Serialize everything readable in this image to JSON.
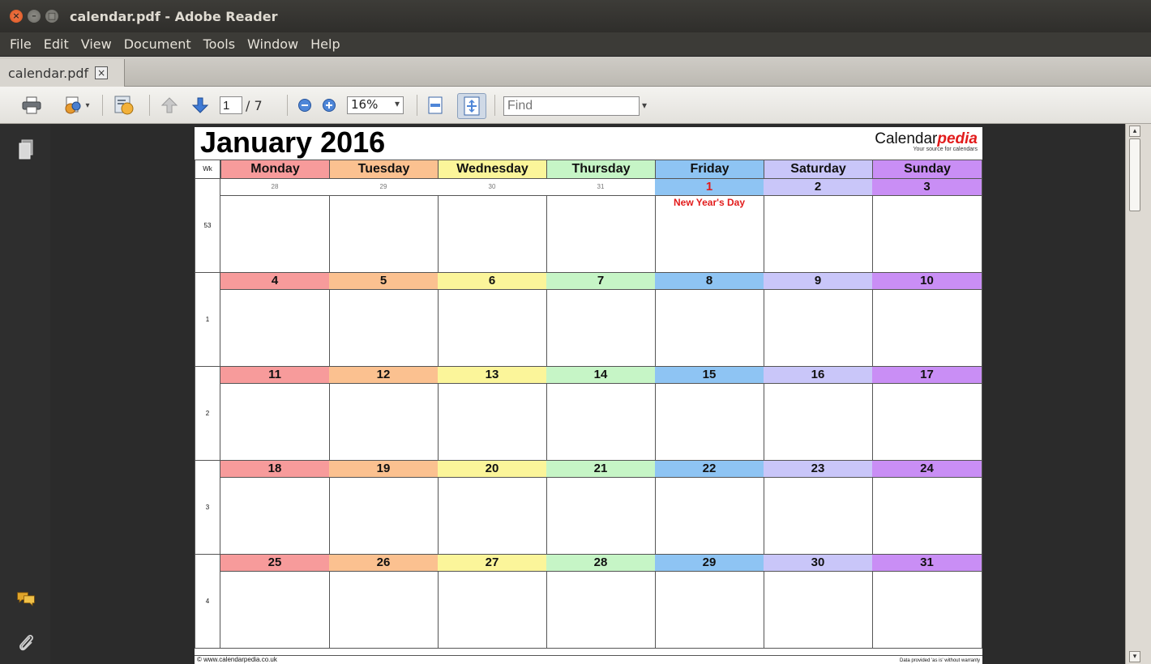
{
  "window": {
    "title": "calendar.pdf - Adobe Reader"
  },
  "menu": [
    "File",
    "Edit",
    "View",
    "Document",
    "Tools",
    "Window",
    "Help"
  ],
  "tab": {
    "label": "calendar.pdf",
    "close": "×"
  },
  "toolbar": {
    "page_current": "1",
    "page_total": "/ 7",
    "zoom": "16%",
    "find_placeholder": "Find"
  },
  "calendar": {
    "title": "January 2016",
    "brand_name": "Calendar",
    "brand_accent": "pedia",
    "brand_tagline": "Your source for calendars",
    "week_header": "Wk",
    "day_names": [
      "Monday",
      "Tuesday",
      "Wednesday",
      "Thursday",
      "Friday",
      "Saturday",
      "Sunday"
    ],
    "day_colors": [
      "#f79b9b",
      "#fbc190",
      "#fbf59a",
      "#c6f5c6",
      "#8ec4f3",
      "#c9c6f9",
      "#c98ef5"
    ],
    "weeks": [
      {
        "wk": "53",
        "days": [
          {
            "n": "28",
            "other": true
          },
          {
            "n": "29",
            "other": true
          },
          {
            "n": "30",
            "other": true
          },
          {
            "n": "31",
            "other": true
          },
          {
            "n": "1",
            "holiday": "New Year's Day"
          },
          {
            "n": "2"
          },
          {
            "n": "3"
          }
        ]
      },
      {
        "wk": "1",
        "days": [
          {
            "n": "4"
          },
          {
            "n": "5"
          },
          {
            "n": "6"
          },
          {
            "n": "7"
          },
          {
            "n": "8"
          },
          {
            "n": "9"
          },
          {
            "n": "10"
          }
        ]
      },
      {
        "wk": "2",
        "days": [
          {
            "n": "11"
          },
          {
            "n": "12"
          },
          {
            "n": "13"
          },
          {
            "n": "14"
          },
          {
            "n": "15"
          },
          {
            "n": "16"
          },
          {
            "n": "17"
          }
        ]
      },
      {
        "wk": "3",
        "days": [
          {
            "n": "18"
          },
          {
            "n": "19"
          },
          {
            "n": "20"
          },
          {
            "n": "21"
          },
          {
            "n": "22"
          },
          {
            "n": "23"
          },
          {
            "n": "24"
          }
        ]
      },
      {
        "wk": "4",
        "days": [
          {
            "n": "25"
          },
          {
            "n": "26"
          },
          {
            "n": "27"
          },
          {
            "n": "28"
          },
          {
            "n": "29"
          },
          {
            "n": "30"
          },
          {
            "n": "31"
          }
        ]
      }
    ],
    "footer_left": "© www.calendarpedia.co.uk",
    "footer_right": "Data provided 'as is' without warranty"
  }
}
